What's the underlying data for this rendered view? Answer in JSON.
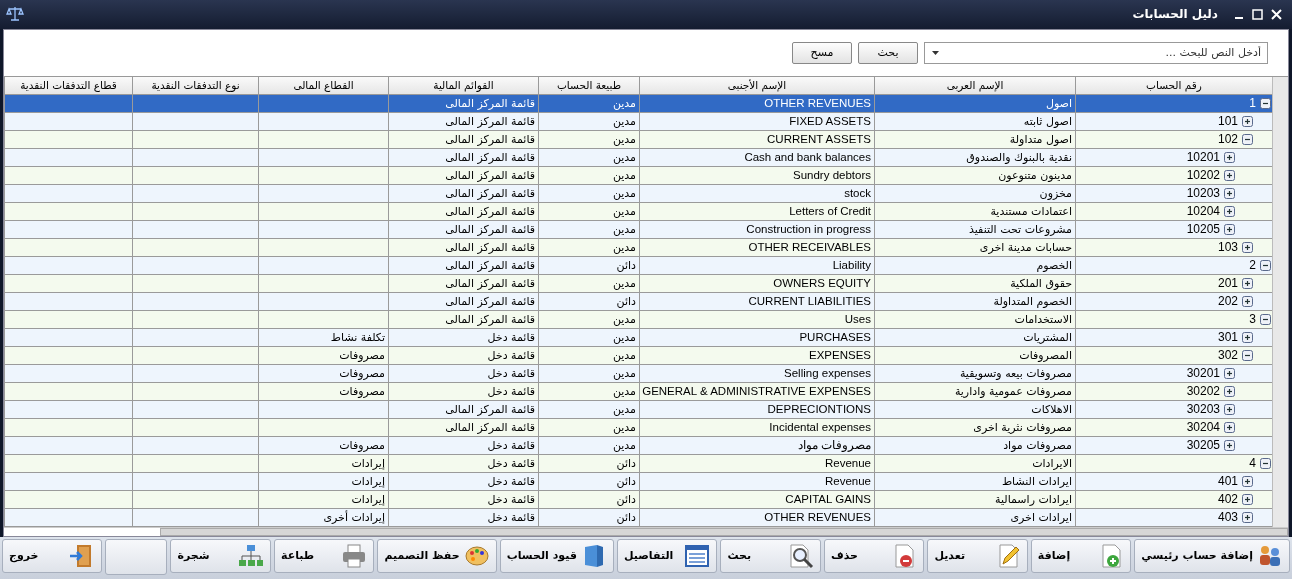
{
  "window": {
    "title": "دليل الحسابات"
  },
  "search": {
    "placeholder": "أدخل النص للبحث ...",
    "buttons": [
      "بحث",
      "مسح"
    ]
  },
  "table": {
    "columns": [
      "رقم الحساب",
      "الإسم العربى",
      "الإسم الأجنبى",
      "طبيعة الحساب",
      "القوائم المالية",
      "القطاع المالى",
      "نوع التدفقات النقدية",
      "قطاع التدفقات النقدية"
    ],
    "accounts": [
      {
        "number": "1",
        "name_ar": "اصول",
        "name_en": "OTHER REVENUES",
        "nature": "مدين",
        "statement": "قائمة المركز المالى",
        "expanded": true,
        "selected": true,
        "children": [
          {
            "number": "101",
            "name_ar": "اصول ثابته",
            "name_en": "FIXED ASSETS",
            "nature": "مدين",
            "statement": "قائمة المركز المالى",
            "expanded": false,
            "selected": false
          },
          {
            "number": "102",
            "name_ar": "اصول متداولة",
            "name_en": "CURRENT ASSETS",
            "nature": "مدين",
            "statement": "قائمة المركز المالى",
            "expanded": true,
            "selected": false,
            "children": [
              {
                "number": "10201",
                "name_ar": "نقدية بالبنوك والصندوق",
                "name_en": "Cash and bank balances",
                "nature": "مدين",
                "statement": "قائمة المركز المالى",
                "expanded": false,
                "selected": false
              },
              {
                "number": "10202",
                "name_ar": "مدينون متنوعون",
                "name_en": "Sundry debtors",
                "nature": "مدين",
                "statement": "قائمة المركز المالى",
                "expanded": false,
                "selected": false
              },
              {
                "number": "10203",
                "name_ar": "مخزون",
                "name_en": "stock",
                "nature": "مدين",
                "statement": "قائمة المركز المالى",
                "expanded": false,
                "selected": false
              },
              {
                "number": "10204",
                "name_ar": "اعتمادات مستندية",
                "name_en": "Letters of Credit",
                "nature": "مدين",
                "statement": "قائمة المركز المالى",
                "expanded": false,
                "selected": false
              },
              {
                "number": "10205",
                "name_ar": "مشروعات تحت التنفيذ",
                "name_en": "Construction in progress",
                "nature": "مدين",
                "statement": "قائمة المركز المالى",
                "expanded": false,
                "selected": false
              }
            ]
          },
          {
            "number": "103",
            "name_ar": "حسابات مدينة اخرى",
            "name_en": "OTHER RECEIVABLES",
            "nature": "مدين",
            "statement": "قائمة المركز المالى",
            "expanded": false,
            "selected": false
          }
        ]
      },
      {
        "number": "2",
        "name_ar": "الخصوم",
        "name_en": "Liability",
        "nature": "دائن",
        "statement": "قائمة المركز المالى",
        "expanded": true,
        "selected": false,
        "children": [
          {
            "number": "201",
            "name_ar": "حقوق الملكية",
            "name_en": "OWNERS EQUITY",
            "nature": "مدين",
            "statement": "قائمة المركز المالى",
            "expanded": false,
            "selected": false
          },
          {
            "number": "202",
            "name_ar": "الخصوم المتداولة",
            "name_en": "CURRENT LIABILITIES",
            "nature": "دائن",
            "statement": "قائمة المركز المالى",
            "expanded": false,
            "selected": false
          }
        ]
      },
      {
        "number": "3",
        "name_ar": "الاستخدامات",
        "name_en": "Uses",
        "nature": "مدين",
        "statement": "قائمة المركز المالى",
        "expanded": true,
        "selected": false,
        "children": [
          {
            "number": "301",
            "name_ar": "المشتريات",
            "name_en": "PURCHASES",
            "nature": "مدين",
            "statement": "قائمة دخل",
            "sector": "تكلفة نشاط",
            "expanded": false,
            "selected": false
          },
          {
            "number": "302",
            "name_ar": "المصروفات",
            "name_en": "EXPENSES",
            "nature": "مدين",
            "statement": "قائمة دخل",
            "sector": "مصروفات",
            "expanded": true,
            "selected": false,
            "children": [
              {
                "number": "30201",
                "name_ar": "مصروفات بيعه وتسويقية",
                "name_en": "Selling expenses",
                "nature": "مدين",
                "statement": "قائمة دخل",
                "sector": "مصروفات",
                "expanded": false,
                "selected": false
              },
              {
                "number": "30202",
                "name_ar": "مصروفات عمومية وادارية",
                "name_en": "GENERAL & ADMINISTRATIVE  EXPENSES",
                "nature": "مدين",
                "statement": "قائمة دخل",
                "sector": "مصروفات",
                "expanded": false,
                "selected": false
              },
              {
                "number": "30203",
                "name_ar": "الاهلاكات",
                "name_en": "DEPRECIONTIONS",
                "nature": "مدين",
                "statement": "قائمة المركز المالى",
                "expanded": false,
                "selected": false
              },
              {
                "number": "30204",
                "name_ar": "مصروفات نثرية اخرى",
                "name_en": "Incidental expenses",
                "nature": "مدين",
                "statement": "قائمة المركز المالى",
                "expanded": false,
                "selected": false
              },
              {
                "number": "30205",
                "name_ar": "مصروفات مواد",
                "name_en": "مصروفات مواد",
                "nature": "مدين",
                "statement": "قائمة دخل",
                "sector": "مصروفات",
                "expanded": false,
                "selected": false
              }
            ]
          }
        ]
      },
      {
        "number": "4",
        "name_ar": "الايرادات",
        "name_en": "Revenue",
        "nature": "دائن",
        "statement": "قائمة دخل",
        "sector": "إيرادات",
        "expanded": true,
        "selected": false,
        "children": [
          {
            "number": "401",
            "name_ar": "ايرادات النشاط",
            "name_en": "Revenue",
            "nature": "دائن",
            "statement": "قائمة دخل",
            "sector": "إيرادات",
            "expanded": false,
            "selected": false
          },
          {
            "number": "402",
            "name_ar": "ايرادات راسمالية",
            "name_en": "CAPITAL GAINS",
            "nature": "دائن",
            "statement": "قائمة دخل",
            "sector": "إيرادات",
            "expanded": false,
            "selected": false
          },
          {
            "number": "403",
            "name_ar": "ايرادات اخرى",
            "name_en": "OTHER REVENUES",
            "nature": "دائن",
            "statement": "قائمة دخل",
            "sector": "إيرادات أخرى",
            "expanded": false,
            "selected": false
          }
        ]
      }
    ]
  },
  "toolbar": [
    "إضافة حساب رئيسي",
    "إضافة",
    "تعديل",
    "حذف",
    "بحث",
    "التفاصيل",
    "قيود الحساب",
    "حفظ التصميم",
    "طباعة",
    "شجرة",
    "خروج"
  ]
}
